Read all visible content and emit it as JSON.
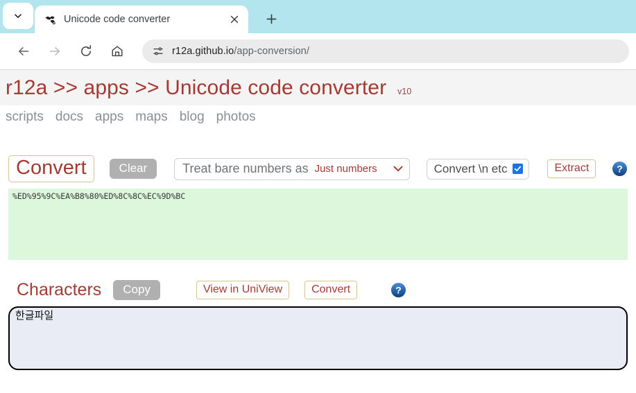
{
  "browser": {
    "tab": {
      "title": "Unicode code converter",
      "favicon_name": "globe-favicon",
      "close_label": "×"
    },
    "tab_list_button": "tab-list-chevron",
    "new_tab_label": "+",
    "back_label": "←",
    "forward_label": "→",
    "reload_label": "⟳",
    "home_label": "⌂",
    "site_info_label": "site-settings",
    "url": {
      "host": "r12a.github.io",
      "path": "/app-conversion/",
      "full": "r12a.github.io/app-conversion/"
    }
  },
  "page": {
    "title": "r12a >> apps >> Unicode code converter",
    "version": "v10",
    "nav": [
      "scripts",
      "docs",
      "apps",
      "maps",
      "blog",
      "photos"
    ],
    "controls": {
      "convert_label": "Convert",
      "clear_label": "Clear",
      "bare_numbers_label": "Treat bare numbers as",
      "bare_numbers_value": "Just numbers",
      "bare_numbers_options": [
        "Just numbers"
      ],
      "convert_escapes_label": "Convert \\n etc",
      "convert_escapes_checked": "✓",
      "extract_label": "Extract",
      "help_label": "?"
    },
    "encoded_output": "%ED%95%9C%EA%B8%80%ED%8C%8C%EC%9D%BC",
    "characters": {
      "heading": "Characters",
      "copy_label": "Copy",
      "view_in_uniview_label": "View in UniView",
      "convert_label": "Convert",
      "help_label": "?",
      "value": "한글파일"
    }
  },
  "colors": {
    "accent_red": "#a33a33",
    "chrome_tabstrip": "#b3e5ef",
    "output_green": "#ddf7dd",
    "chars_bg": "#e9ebf5",
    "checkbox_blue": "#1a73e8",
    "button_gray": "#b0b0b0",
    "button_border_tan": "#d8c48c"
  }
}
